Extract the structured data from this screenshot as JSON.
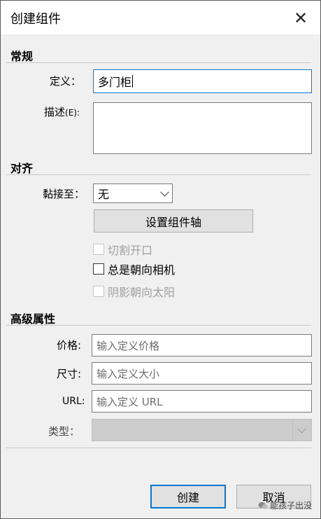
{
  "dialog": {
    "title": "创建组件",
    "close_glyph": "✕"
  },
  "sections": {
    "general": "常规",
    "align": "对齐",
    "advanced": "高级属性"
  },
  "general": {
    "definition_label": "定义：",
    "definition_value": "多门柜",
    "description_label": "描述",
    "description_hotkey": "(E):",
    "description_value": ""
  },
  "align": {
    "glue_label": "黏接至：",
    "glue_value": "无",
    "set_axes_button": "设置组件轴",
    "cut_opening": "切割开口",
    "always_face_camera": "总是朝向相机",
    "shadows_face_sun": "阴影朝向太阳"
  },
  "advanced": {
    "price_label": "价格:",
    "price_placeholder": "输入定义价格",
    "size_label": "尺寸:",
    "size_placeholder": "输入定义大小",
    "url_label": "URL:",
    "url_placeholder": "输入定义 URL",
    "type_label": "类型：",
    "type_value": ""
  },
  "footer": {
    "create_button": "创建",
    "cancel_button": "取消"
  },
  "watermark": {
    "text": "能孩子出没"
  },
  "colors": {
    "accent": "#0078d7",
    "window_bg": "#f0f0f0"
  }
}
